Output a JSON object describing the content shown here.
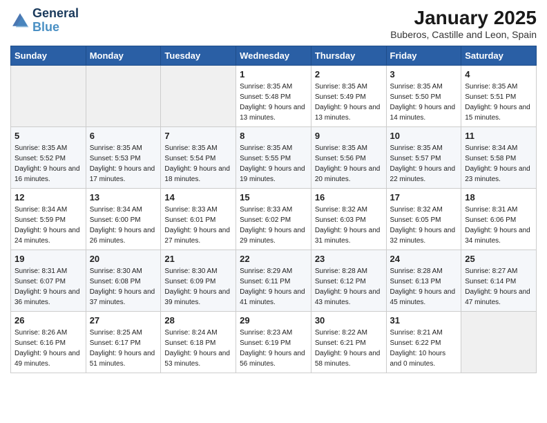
{
  "logo": {
    "line1": "General",
    "line2": "Blue"
  },
  "title": "January 2025",
  "location": "Buberos, Castille and Leon, Spain",
  "weekdays": [
    "Sunday",
    "Monday",
    "Tuesday",
    "Wednesday",
    "Thursday",
    "Friday",
    "Saturday"
  ],
  "weeks": [
    [
      {
        "day": "",
        "info": ""
      },
      {
        "day": "",
        "info": ""
      },
      {
        "day": "",
        "info": ""
      },
      {
        "day": "1",
        "sunrise": "8:35 AM",
        "sunset": "5:48 PM",
        "daylight": "9 hours and 13 minutes."
      },
      {
        "day": "2",
        "sunrise": "8:35 AM",
        "sunset": "5:49 PM",
        "daylight": "9 hours and 13 minutes."
      },
      {
        "day": "3",
        "sunrise": "8:35 AM",
        "sunset": "5:50 PM",
        "daylight": "9 hours and 14 minutes."
      },
      {
        "day": "4",
        "sunrise": "8:35 AM",
        "sunset": "5:51 PM",
        "daylight": "9 hours and 15 minutes."
      }
    ],
    [
      {
        "day": "5",
        "sunrise": "8:35 AM",
        "sunset": "5:52 PM",
        "daylight": "9 hours and 16 minutes."
      },
      {
        "day": "6",
        "sunrise": "8:35 AM",
        "sunset": "5:53 PM",
        "daylight": "9 hours and 17 minutes."
      },
      {
        "day": "7",
        "sunrise": "8:35 AM",
        "sunset": "5:54 PM",
        "daylight": "9 hours and 18 minutes."
      },
      {
        "day": "8",
        "sunrise": "8:35 AM",
        "sunset": "5:55 PM",
        "daylight": "9 hours and 19 minutes."
      },
      {
        "day": "9",
        "sunrise": "8:35 AM",
        "sunset": "5:56 PM",
        "daylight": "9 hours and 20 minutes."
      },
      {
        "day": "10",
        "sunrise": "8:35 AM",
        "sunset": "5:57 PM",
        "daylight": "9 hours and 22 minutes."
      },
      {
        "day": "11",
        "sunrise": "8:34 AM",
        "sunset": "5:58 PM",
        "daylight": "9 hours and 23 minutes."
      }
    ],
    [
      {
        "day": "12",
        "sunrise": "8:34 AM",
        "sunset": "5:59 PM",
        "daylight": "9 hours and 24 minutes."
      },
      {
        "day": "13",
        "sunrise": "8:34 AM",
        "sunset": "6:00 PM",
        "daylight": "9 hours and 26 minutes."
      },
      {
        "day": "14",
        "sunrise": "8:33 AM",
        "sunset": "6:01 PM",
        "daylight": "9 hours and 27 minutes."
      },
      {
        "day": "15",
        "sunrise": "8:33 AM",
        "sunset": "6:02 PM",
        "daylight": "9 hours and 29 minutes."
      },
      {
        "day": "16",
        "sunrise": "8:32 AM",
        "sunset": "6:03 PM",
        "daylight": "9 hours and 31 minutes."
      },
      {
        "day": "17",
        "sunrise": "8:32 AM",
        "sunset": "6:05 PM",
        "daylight": "9 hours and 32 minutes."
      },
      {
        "day": "18",
        "sunrise": "8:31 AM",
        "sunset": "6:06 PM",
        "daylight": "9 hours and 34 minutes."
      }
    ],
    [
      {
        "day": "19",
        "sunrise": "8:31 AM",
        "sunset": "6:07 PM",
        "daylight": "9 hours and 36 minutes."
      },
      {
        "day": "20",
        "sunrise": "8:30 AM",
        "sunset": "6:08 PM",
        "daylight": "9 hours and 37 minutes."
      },
      {
        "day": "21",
        "sunrise": "8:30 AM",
        "sunset": "6:09 PM",
        "daylight": "9 hours and 39 minutes."
      },
      {
        "day": "22",
        "sunrise": "8:29 AM",
        "sunset": "6:11 PM",
        "daylight": "9 hours and 41 minutes."
      },
      {
        "day": "23",
        "sunrise": "8:28 AM",
        "sunset": "6:12 PM",
        "daylight": "9 hours and 43 minutes."
      },
      {
        "day": "24",
        "sunrise": "8:28 AM",
        "sunset": "6:13 PM",
        "daylight": "9 hours and 45 minutes."
      },
      {
        "day": "25",
        "sunrise": "8:27 AM",
        "sunset": "6:14 PM",
        "daylight": "9 hours and 47 minutes."
      }
    ],
    [
      {
        "day": "26",
        "sunrise": "8:26 AM",
        "sunset": "6:16 PM",
        "daylight": "9 hours and 49 minutes."
      },
      {
        "day": "27",
        "sunrise": "8:25 AM",
        "sunset": "6:17 PM",
        "daylight": "9 hours and 51 minutes."
      },
      {
        "day": "28",
        "sunrise": "8:24 AM",
        "sunset": "6:18 PM",
        "daylight": "9 hours and 53 minutes."
      },
      {
        "day": "29",
        "sunrise": "8:23 AM",
        "sunset": "6:19 PM",
        "daylight": "9 hours and 56 minutes."
      },
      {
        "day": "30",
        "sunrise": "8:22 AM",
        "sunset": "6:21 PM",
        "daylight": "9 hours and 58 minutes."
      },
      {
        "day": "31",
        "sunrise": "8:21 AM",
        "sunset": "6:22 PM",
        "daylight": "10 hours and 0 minutes."
      },
      {
        "day": "",
        "info": ""
      }
    ]
  ],
  "labels": {
    "sunrise": "Sunrise:",
    "sunset": "Sunset:",
    "daylight": "Daylight hours"
  }
}
